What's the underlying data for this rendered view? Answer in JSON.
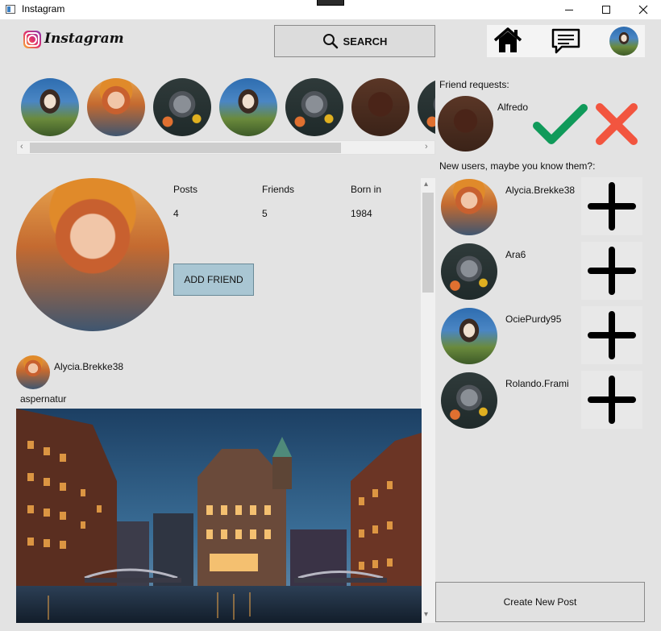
{
  "window": {
    "title": "Instagram"
  },
  "header": {
    "brand": "Instagram",
    "search_label": "SEARCH"
  },
  "stories": [
    "b",
    "a",
    "c",
    "b",
    "c",
    "d",
    "c"
  ],
  "profile": {
    "stats": [
      {
        "label": "Posts",
        "value": "4"
      },
      {
        "label": "Friends",
        "value": "5"
      },
      {
        "label": "Born in",
        "value": "1984"
      }
    ],
    "add_friend_label": "ADD FRIEND"
  },
  "post": {
    "username": "Alycia.Brekke38",
    "caption": "aspernatur"
  },
  "friend_requests": {
    "title": "Friend requests:",
    "name": "Alfredo"
  },
  "new_users": {
    "title": "New users, maybe you know them?:",
    "users": [
      {
        "name": "Alycia.Brekke38",
        "avatar": "a"
      },
      {
        "name": "Ara6",
        "avatar": "c"
      },
      {
        "name": "OciePurdy95",
        "avatar": "b"
      },
      {
        "name": "Rolando.Frami",
        "avatar": "c"
      }
    ]
  },
  "create_post_label": "Create New Post",
  "colors": {
    "accept": "#109a5a",
    "reject": "#f2553f",
    "add_friend_bg": "#a9c6d3"
  },
  "icons": [
    "home-icon",
    "message-icon",
    "search-icon",
    "check-icon",
    "x-icon",
    "plus-icon"
  ]
}
